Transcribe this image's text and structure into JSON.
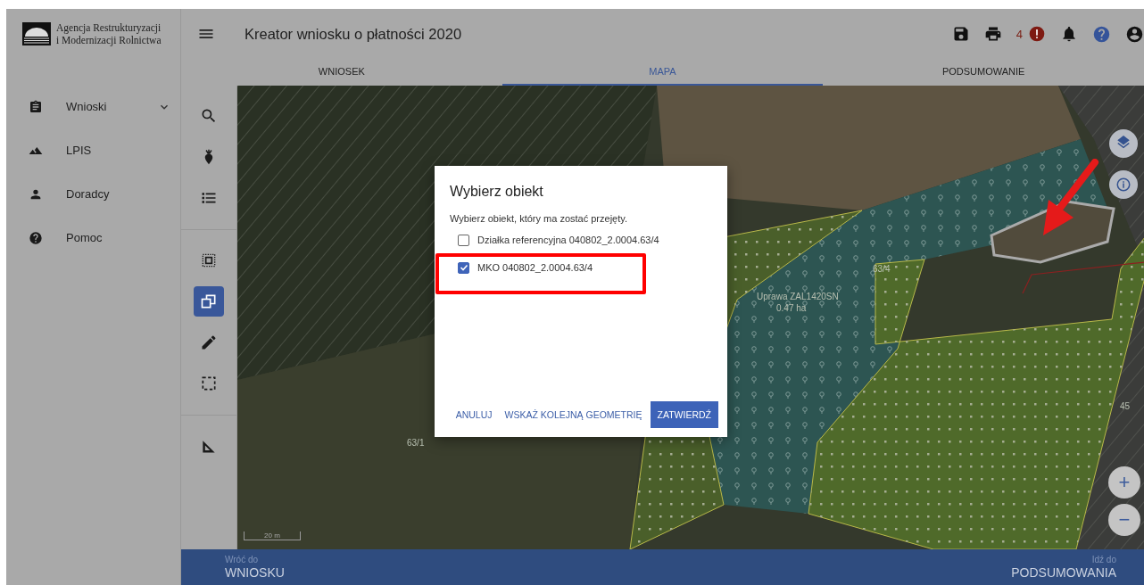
{
  "logo": {
    "lines": [
      "Agencja Restrukturyzacji",
      "i Modernizacji Rolnictwa"
    ]
  },
  "header": {
    "title": "Kreator wniosku o płatności 2020",
    "alert_count": "4"
  },
  "tabs": [
    {
      "label": "WNIOSEK",
      "selected": false
    },
    {
      "label": "MAPA",
      "selected": true
    },
    {
      "label": "PODSUMOWANIE",
      "selected": false
    }
  ],
  "sidebar": {
    "items": [
      {
        "label": "Wnioski",
        "has_submenu": true
      },
      {
        "label": "LPIS",
        "has_submenu": false
      },
      {
        "label": "Doradcy",
        "has_submenu": false
      },
      {
        "label": "Pomoc",
        "has_submenu": false
      }
    ]
  },
  "tool_groups": [
    {
      "tools": [
        {
          "selected": false
        },
        {
          "selected": false
        },
        {
          "selected": false
        }
      ]
    },
    {
      "tools": [
        {
          "selected": false
        },
        {
          "selected": true
        },
        {
          "selected": false
        },
        {
          "selected": false
        }
      ]
    },
    {
      "tools": [
        {
          "selected": false
        }
      ]
    }
  ],
  "map": {
    "labels": [
      "63/4",
      "Uprawa ZAL1420SN",
      "0.47 ha",
      "63/1",
      "45"
    ],
    "scale": "20 m",
    "zoom_in": "+",
    "zoom_out": "−"
  },
  "dialog": {
    "title": "Wybierz obiekt",
    "message": "Wybierz obiekt, który ma zostać przejęty.",
    "options": [
      {
        "label": "Działka referencyjna 040802_2.0004.63/4",
        "checked": false
      },
      {
        "label": "MKO 040802_2.0004.63/4",
        "checked": true
      }
    ],
    "buttons": [
      {
        "label": "ANULUJ",
        "kind": "text"
      },
      {
        "label": "WSKAŻ KOLEJNĄ GEOMETRIĘ",
        "kind": "text"
      },
      {
        "label": "ZATWIERDŹ",
        "kind": "primary"
      }
    ]
  },
  "footer": {
    "back": {
      "caption": "Wróć do",
      "target": "WNIOSKU"
    },
    "next": {
      "caption": "Idź do",
      "target": "PODSUMOWANIA"
    }
  }
}
